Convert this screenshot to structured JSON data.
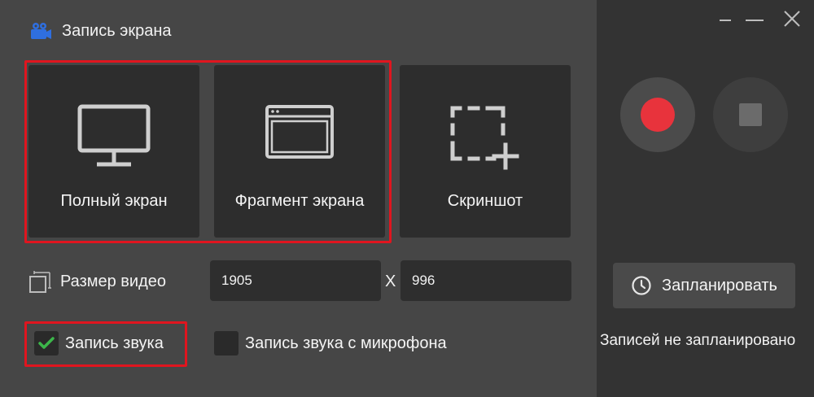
{
  "app": {
    "title": "Запись экрана",
    "icon": "camera-icon",
    "icon_color": "#2f6fe0"
  },
  "modes": {
    "full_screen": "Полный экран",
    "fragment": "Фрагмент экрана",
    "screenshot": "Скриншот"
  },
  "video_size": {
    "label": "Размер видео",
    "width": "1905",
    "separator": "X",
    "height": "996"
  },
  "audio": {
    "system": {
      "label": "Запись звука",
      "checked": true
    },
    "mic": {
      "label": "Запись звука с микрофона",
      "checked": false
    }
  },
  "controls": {
    "record_color": "#e8333c",
    "schedule_label": "Запланировать",
    "schedule_status": "Записей не запланировано"
  },
  "colors": {
    "highlight": "#e0151f",
    "check": "#3cb64a"
  }
}
